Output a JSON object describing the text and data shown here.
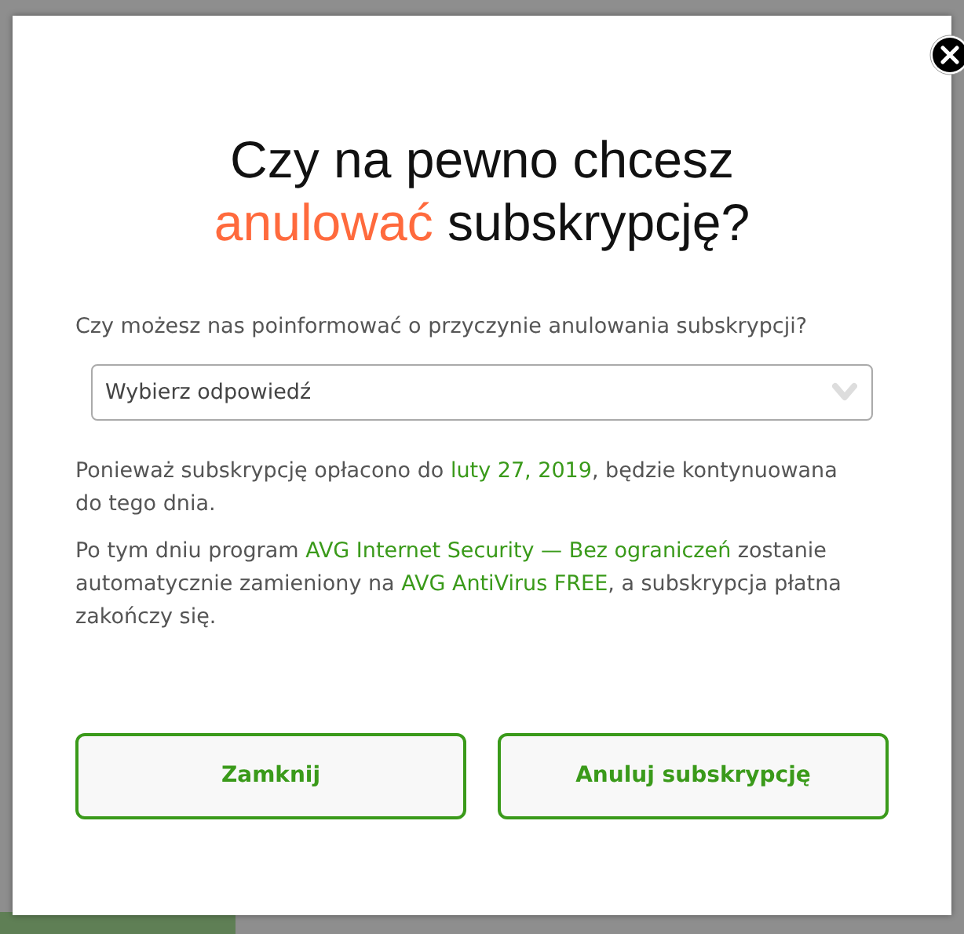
{
  "dialog": {
    "title": [
      {
        "text": "Czy na pewno chcesz",
        "accent": false
      },
      {
        "text": "anulować",
        "accent": true
      },
      {
        "text": " subskrypcję?",
        "accent": false
      }
    ],
    "question": "Czy możesz nas poinformować o przyczynie anulowania subskrypcji?",
    "reason_select": {
      "placeholder": "Wybierz odpowiedź"
    },
    "paragraphs": [
      [
        {
          "text": "Ponieważ subskrypcję opłacono do ",
          "link": false
        },
        {
          "text": "luty 27, 2019",
          "link": true
        },
        {
          "text": ", będzie kontynuowana do tego dnia.",
          "link": false
        }
      ],
      [
        {
          "text": "Po tym dniu program ",
          "link": false
        },
        {
          "text": "AVG Internet Security — Bez ograniczeń",
          "link": true
        },
        {
          "text": " zostanie automatycznie zamieniony na ",
          "link": false
        },
        {
          "text": "AVG AntiVirus FREE",
          "link": true
        },
        {
          "text": ", a subskrypcja płatna zakończy się.",
          "link": false
        }
      ]
    ],
    "buttons": [
      "Zamknij",
      "Anuluj subskrypcję"
    ]
  }
}
